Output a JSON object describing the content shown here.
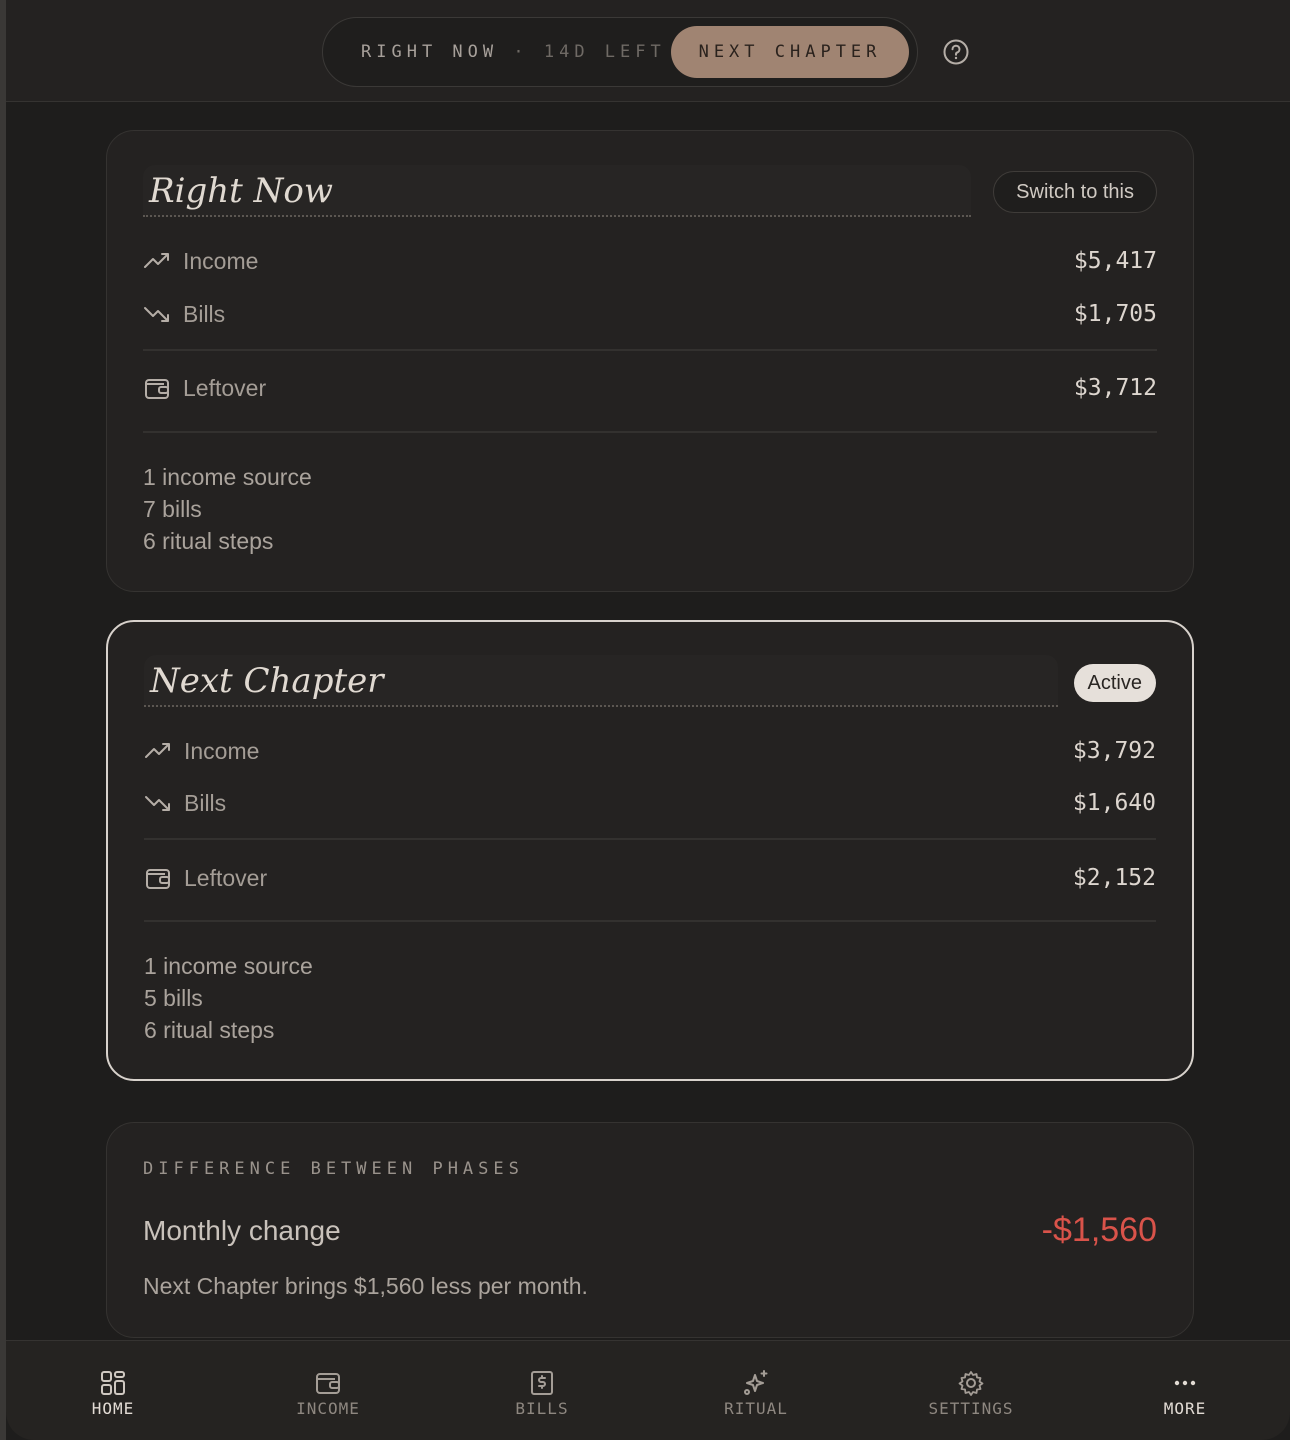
{
  "header": {
    "seg_right_label": "RIGHT NOW",
    "seg_right_sub": "· 14D LEFT",
    "seg_next_label": "NEXT CHAPTER",
    "help_icon": "help-circle-icon"
  },
  "phases": [
    {
      "name": "Right Now",
      "action": "Switch to this",
      "income_label": "Income",
      "income_value": "$5,417",
      "bills_label": "Bills",
      "bills_value": "$1,705",
      "leftover_label": "Leftover",
      "leftover_value": "$3,712",
      "meta": [
        "1 income source",
        "7 bills",
        "6 ritual steps"
      ]
    },
    {
      "name": "Next Chapter",
      "action": "Active",
      "income_label": "Income",
      "income_value": "$3,792",
      "bills_label": "Bills",
      "bills_value": "$1,640",
      "leftover_label": "Leftover",
      "leftover_value": "$2,152",
      "meta": [
        "1 income source",
        "5 bills",
        "6 ritual steps"
      ]
    }
  ],
  "difference": {
    "title": "DIFFERENCE BETWEEN PHASES",
    "label": "Monthly change",
    "value": "-$1,560",
    "note": "Next Chapter brings $1,560 less per month.",
    "value_color": "#d9534a"
  },
  "nav": [
    {
      "label": "HOME",
      "icon": "grid-icon"
    },
    {
      "label": "INCOME",
      "icon": "wallet-icon"
    },
    {
      "label": "BILLS",
      "icon": "receipt-dollar-icon"
    },
    {
      "label": "RITUAL",
      "icon": "sparkles-icon"
    },
    {
      "label": "SETTINGS",
      "icon": "gear-icon"
    },
    {
      "label": "MORE",
      "icon": "more-dots-icon"
    }
  ],
  "colors": {
    "accent": "#a08472",
    "background": "#1e1d1c",
    "card": "#242221",
    "negative": "#d9534a"
  }
}
